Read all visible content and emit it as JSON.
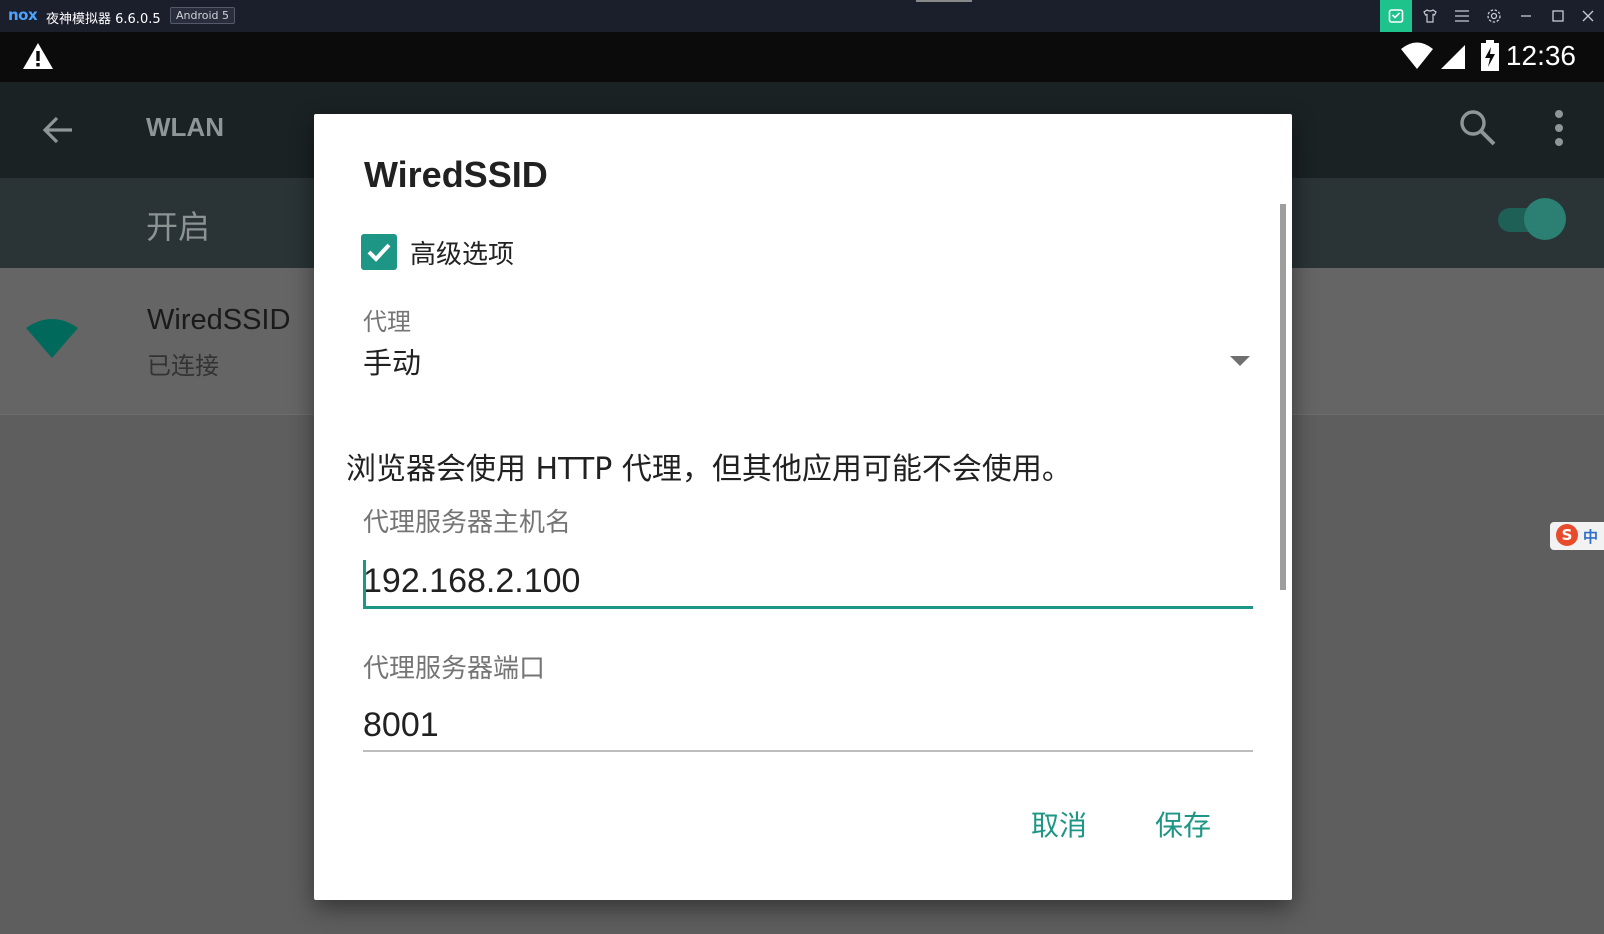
{
  "emulator": {
    "logo": "nox",
    "title": "夜神模拟器 6.6.0.5",
    "badge": "Android 5",
    "buttons": [
      "android-assistant-icon",
      "skin-icon",
      "menu-icon",
      "settings-icon",
      "minimize-icon",
      "maximize-icon",
      "close-icon"
    ]
  },
  "status_bar": {
    "time": "12:36",
    "icons": [
      "warning-icon",
      "wifi-icon",
      "signal-icon",
      "battery-charging-icon"
    ]
  },
  "toolbar": {
    "title": "WLAN"
  },
  "wifi_switch": {
    "label": "开启",
    "state": "on"
  },
  "networks": [
    {
      "name": "WiredSSID",
      "status": "已连接"
    }
  ],
  "dialog": {
    "title": "WiredSSID",
    "advanced_options_label": "高级选项",
    "advanced_checked": true,
    "proxy_label": "代理",
    "proxy_value": "手动",
    "proxy_warning": "浏览器会使用 HTTP 代理，但其他应用可能不会使用。",
    "host_label": "代理服务器主机名",
    "host_value": "192.168.2.100",
    "port_label": "代理服务器端口",
    "port_value": "8001",
    "cancel_label": "取消",
    "save_label": "保存"
  },
  "ime": {
    "brand_letter": "S",
    "mode": "中"
  },
  "colors": {
    "accent": "#1e9685",
    "emulator_bar": "#1b1e2b",
    "emulator_active": "#1ec28b"
  }
}
